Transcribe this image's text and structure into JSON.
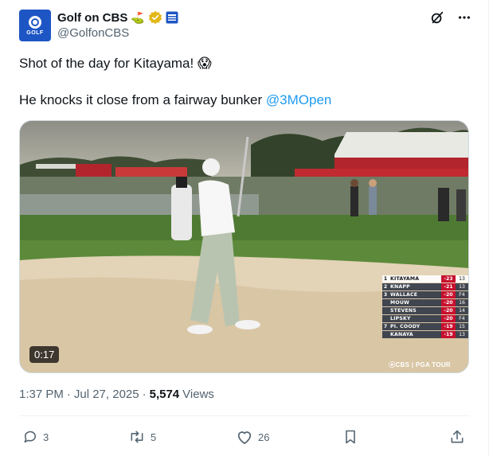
{
  "author": {
    "display_name": "Golf on CBS",
    "handle": "@GolfonCBS",
    "avatar_text": "GOLF",
    "emoji": "⛳",
    "verified": true
  },
  "post": {
    "line1": "Shot of the day for Kitayama! 😱",
    "line2": "He knocks it close from a fairway bunker ",
    "mention": "@3MOpen"
  },
  "video": {
    "duration": "0:17",
    "broadcast_logo": "⦿CBS | PGA TOUR",
    "leaderboard": [
      {
        "pos": "1",
        "name": "KITAYAMA",
        "score": "-23",
        "thru": "13"
      },
      {
        "pos": "2",
        "name": "KNAPP",
        "score": "-21",
        "thru": "13"
      },
      {
        "pos": "3",
        "name": "WALLACE",
        "score": "-20",
        "thru": "F4"
      },
      {
        "pos": "",
        "name": "MOUW",
        "score": "-20",
        "thru": "16"
      },
      {
        "pos": "",
        "name": "STEVENS",
        "score": "-20",
        "thru": "14"
      },
      {
        "pos": "",
        "name": "LIPSKY",
        "score": "-20",
        "thru": "F4"
      },
      {
        "pos": "7",
        "name": "PI. COODY",
        "score": "-19",
        "thru": "15"
      },
      {
        "pos": "",
        "name": "KANAYA",
        "score": "-19",
        "thru": "13"
      }
    ]
  },
  "meta": {
    "time": "1:37 PM",
    "date": "Jul 27, 2025",
    "separator1": "·",
    "separator2": "·",
    "views_count": "5,574",
    "views_label": "Views"
  },
  "actions": {
    "replies": "3",
    "reposts": "5",
    "likes": "26"
  },
  "colors": {
    "accent": "#1d9bf0",
    "verified_gold": "#e2b719",
    "secondary_text": "#536471"
  }
}
